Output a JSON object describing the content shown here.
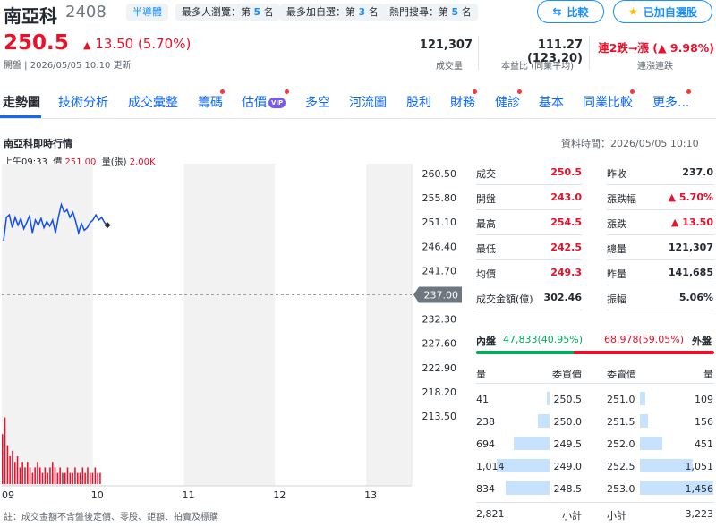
{
  "header": {
    "name": "南亞科",
    "code": "2408",
    "tags": [
      {
        "text": "半導體"
      },
      {
        "text": "最多人瀏覽：第",
        "num": "5",
        "suffix": "名"
      },
      {
        "text": "最多加自選：第",
        "num": "3",
        "suffix": "名"
      },
      {
        "text": "熱門搜尋：第",
        "num": "5",
        "suffix": "名"
      }
    ],
    "compare_label": "比較",
    "watchlist_label": "已加自選股",
    "price": "250.5",
    "change": "13.50 (5.70%)",
    "open_time": "開盤 | 2026/05/05 10:10 更新",
    "stats": [
      {
        "value": "121,307",
        "label": "成交量"
      },
      {
        "value": "111.27 (123.20)",
        "label": "本益比 (同業平均)"
      },
      {
        "value": "連2跌→漲 (▲ 9.98%)",
        "label": "連漲連跌"
      }
    ]
  },
  "tabs": [
    "走勢圖",
    "技術分析",
    "成交彙整",
    "籌碼",
    "估價",
    "多空",
    "河流圖",
    "股利",
    "財務",
    "健診",
    "基本",
    "同業比較",
    "更多..."
  ],
  "vip_label": "VIP",
  "chart": {
    "title": "南亞科即時行情",
    "info_time": "上午09:33",
    "info_price_label": "價",
    "info_price": "251.00",
    "info_vol_label": "量(張)",
    "info_vol": "2.00K",
    "data_time": "資料時間：2026/05/05 10:10",
    "note": "註：成交金額不含盤後定價、零股、鉅額、拍賣及標購"
  },
  "chart_data": {
    "type": "line",
    "y_ticks": [
      "260.50",
      "255.80",
      "251.10",
      "246.40",
      "241.70",
      "237.00",
      "232.30",
      "227.60",
      "222.90",
      "218.20",
      "213.50"
    ],
    "x_ticks": [
      "09",
      "10",
      "11",
      "12",
      "13"
    ],
    "ylim": [
      213.5,
      260.5
    ],
    "reference": 237.0,
    "price_series": [
      247.5,
      252.0,
      252.5,
      250.0,
      252.0,
      250.5,
      251.8,
      249.8,
      251.0,
      252.3,
      249.0,
      251.5,
      250.5,
      251.8,
      250.0,
      251.2,
      250.3,
      251.5,
      249.0,
      252.0,
      254.5,
      253.0,
      253.5,
      252.0,
      253.0,
      251.2,
      249.0,
      250.8,
      249.5,
      250.0,
      251.0,
      251.5,
      252.5,
      251.5,
      252.0,
      251.0,
      250.5
    ],
    "volume_series": [
      9,
      12,
      7,
      5,
      6,
      4,
      5,
      3,
      4,
      3,
      4,
      3,
      2,
      3,
      4,
      3,
      2,
      3,
      2,
      3,
      4,
      3,
      2,
      3,
      2,
      2,
      3,
      2,
      2,
      3,
      2,
      2,
      3,
      2,
      3,
      2,
      2,
      3,
      2,
      2
    ]
  },
  "quote": {
    "rows": [
      [
        {
          "l": "成交",
          "v": "250.5",
          "c": "red"
        },
        {
          "l": "昨收",
          "v": "237.0",
          "c": "dark"
        }
      ],
      [
        {
          "l": "開盤",
          "v": "243.0",
          "c": "red"
        },
        {
          "l": "漲跌幅",
          "v": "▲ 5.70%",
          "c": "red"
        }
      ],
      [
        {
          "l": "最高",
          "v": "254.5",
          "c": "red"
        },
        {
          "l": "漲跌",
          "v": "▲ 13.50",
          "c": "red"
        }
      ],
      [
        {
          "l": "最低",
          "v": "242.5",
          "c": "red"
        },
        {
          "l": "總量",
          "v": "121,307",
          "c": "dark"
        }
      ],
      [
        {
          "l": "均價",
          "v": "249.3",
          "c": "red"
        },
        {
          "l": "昨量",
          "v": "141,685",
          "c": "dark"
        }
      ],
      [
        {
          "l": "成交金額(億)",
          "v": "302.46",
          "c": "dark"
        },
        {
          "l": "振幅",
          "v": "5.06%",
          "c": "dark"
        }
      ]
    ]
  },
  "inout": {
    "in_label": "內盤",
    "in_value": "47,833",
    "in_pct": "(40.95%)",
    "in_ratio": 0.4095,
    "out_value": "68,978",
    "out_pct": "(59.05%)",
    "out_label": "外盤"
  },
  "orderbook": {
    "headers": [
      "量",
      "委買價",
      "委賣價",
      "量"
    ],
    "rows": [
      {
        "bq": "41",
        "bp": "250.5",
        "ap": "251.0",
        "aq": "109",
        "bf": 0.03,
        "af": 0.07
      },
      {
        "bq": "238",
        "bp": "250.0",
        "ap": "251.5",
        "aq": "156",
        "bf": 0.16,
        "af": 0.11
      },
      {
        "bq": "694",
        "bp": "249.5",
        "ap": "252.0",
        "aq": "451",
        "bf": 0.48,
        "af": 0.31
      },
      {
        "bq": "1,014",
        "bp": "249.0",
        "ap": "252.5",
        "aq": "1,051",
        "bf": 0.7,
        "af": 0.72
      },
      {
        "bq": "834",
        "bp": "248.5",
        "ap": "253.0",
        "aq": "1,456",
        "bf": 0.58,
        "af": 1.0
      }
    ],
    "total_bid": "2,821",
    "total_label": "小計",
    "total_ask": "3,223"
  },
  "colors": {
    "up": "#eb0f29",
    "down": "#00ab5e",
    "link": "#0f69ff",
    "line": "#0f4cf2"
  }
}
